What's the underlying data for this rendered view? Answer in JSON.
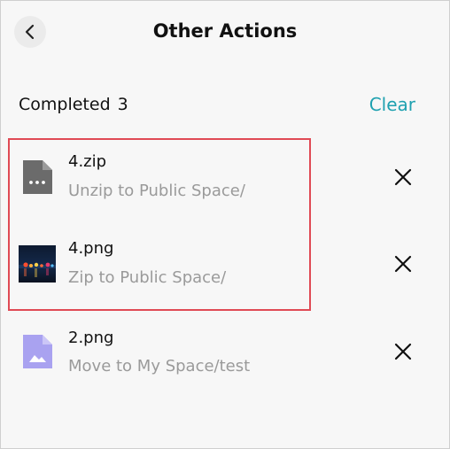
{
  "header": {
    "title": "Other Actions",
    "back_icon": "chevron-left-icon"
  },
  "section": {
    "title": "Completed",
    "count": "3",
    "clear_label": "Clear"
  },
  "items": [
    {
      "name": "4.zip",
      "action": "Unzip to Public Space/",
      "icon": "zip-file-icon"
    },
    {
      "name": "4.png",
      "action": "Zip to Public Space/",
      "icon": "image-thumbnail"
    },
    {
      "name": "2.png",
      "action": "Move to My Space/test",
      "icon": "image-file-icon"
    }
  ],
  "colors": {
    "accent": "#1fa1b0",
    "highlight_border": "#e04a55",
    "secondary_text": "#9a9a9a",
    "image_file_icon": "#a9a2f0"
  }
}
